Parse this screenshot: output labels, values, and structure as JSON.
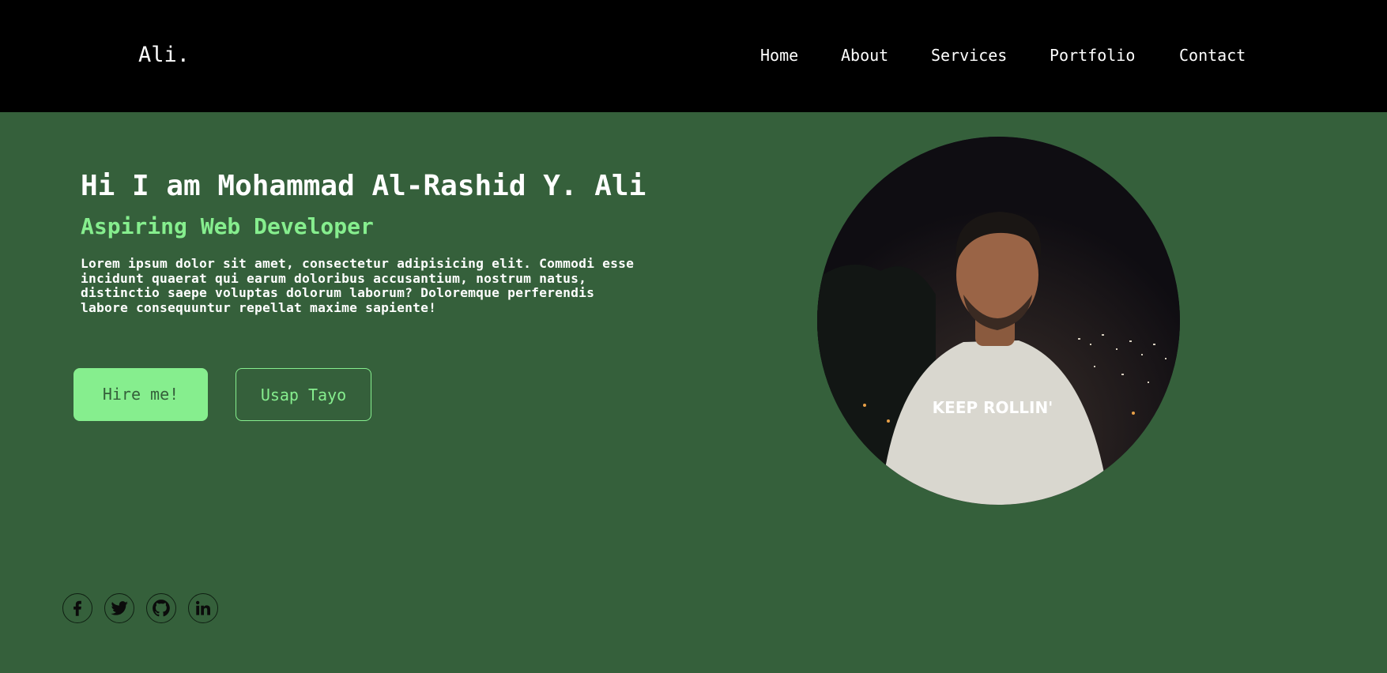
{
  "header": {
    "logo": "Ali.",
    "nav": [
      "Home",
      "About",
      "Services",
      "Portfolio",
      "Contact"
    ]
  },
  "hero": {
    "title": "Hi I am Mohammad Al-Rashid Y. Ali",
    "role": "Aspiring Web Developer",
    "description": "Lorem ipsum dolor sit amet, consectetur adipisicing elit. Commodi esse incidunt quaerat qui earum doloribus accusantium, nostrum natus, distinctio saepe voluptas dolorum laborum? Doloremque perferendis labore consequuntur repellat maxime sapiente!",
    "hire_button": "Hire me!",
    "usap_button": "Usap Tayo",
    "photo_shirt_text": "KEEP ROLLIN'"
  },
  "socials": [
    {
      "icon": "facebook-icon"
    },
    {
      "icon": "twitter-icon"
    },
    {
      "icon": "github-icon"
    },
    {
      "icon": "linkedin-icon"
    }
  ],
  "colors": {
    "background": "#35603b",
    "header": "#000000",
    "accent": "#86ee8e",
    "text": "#ffffff"
  }
}
